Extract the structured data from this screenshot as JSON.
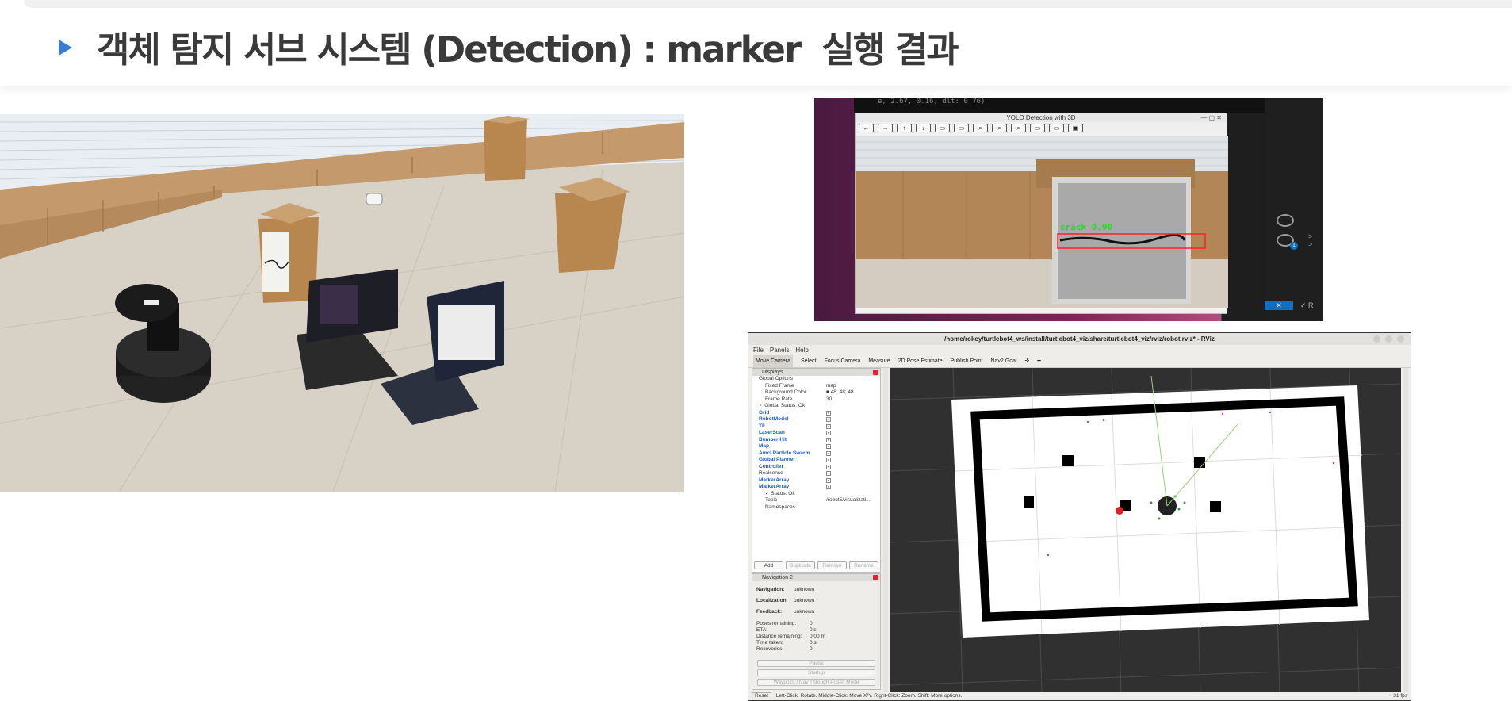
{
  "slide": {
    "title": "객체 탐지 서브 시스템 (Detection) : marker  실행 결과"
  },
  "yolo_window": {
    "terminal_text": "e, 2.67, 0.16, dlt: 0.76)",
    "title": "YOLO Detection with 3D",
    "window_controls": "—  ▢  ✕",
    "toolbar": [
      "←",
      "→",
      "↑",
      "↓",
      "▭",
      "▭",
      "⌕",
      "⌕",
      "⌕",
      "▭",
      "▭",
      "▣"
    ],
    "detection_label": "crack 0.90",
    "sidebar_badge": "1",
    "sidebar_blue": "✕",
    "sidebar_text": "✓ R",
    "sidebar_chevrons": ">"
  },
  "rviz": {
    "window_title": "/home/rokey/turtlebot4_ws/install/turtlebot4_viz/share/turtlebot4_viz/rviz/robot.rviz* - RViz",
    "menu": [
      "File",
      "Panels",
      "Help"
    ],
    "toolbar": [
      "Move Camera",
      "Select",
      "Focus Camera",
      "Measure",
      "2D Pose Estimate",
      "Publish Point",
      "Nav2 Goal",
      "✛",
      "━"
    ],
    "displays_panel_title": "Displays",
    "displays": [
      {
        "label": "Global Options",
        "value": "",
        "blue": false,
        "check": false,
        "indent": 0
      },
      {
        "label": "Fixed Frame",
        "value": "map",
        "blue": false,
        "check": false,
        "indent": 1
      },
      {
        "label": "Background Color",
        "value": "■ 48; 48; 48",
        "blue": false,
        "check": false,
        "indent": 1
      },
      {
        "label": "Frame Rate",
        "value": "30",
        "blue": false,
        "check": false,
        "indent": 1
      },
      {
        "label": "✓ Global Status: Ok",
        "value": "",
        "blue": false,
        "check": false,
        "indent": 0
      },
      {
        "label": "Grid",
        "value": "",
        "blue": true,
        "check": true,
        "indent": 0
      },
      {
        "label": "RobotModel",
        "value": "",
        "blue": true,
        "check": true,
        "indent": 0
      },
      {
        "label": "TF",
        "value": "",
        "blue": true,
        "check": true,
        "indent": 0
      },
      {
        "label": "LaserScan",
        "value": "",
        "blue": true,
        "check": true,
        "indent": 0
      },
      {
        "label": "Bumper Hit",
        "value": "",
        "blue": true,
        "check": true,
        "indent": 0
      },
      {
        "label": "Map",
        "value": "",
        "blue": true,
        "check": true,
        "indent": 0
      },
      {
        "label": "Amcl Particle Swarm",
        "value": "",
        "blue": true,
        "check": true,
        "indent": 0
      },
      {
        "label": "Global Planner",
        "value": "",
        "blue": true,
        "check": true,
        "indent": 0
      },
      {
        "label": "Controller",
        "value": "",
        "blue": true,
        "check": true,
        "indent": 0
      },
      {
        "label": "Realsense",
        "value": "",
        "blue": false,
        "check": true,
        "indent": 0
      },
      {
        "label": "MarkerArray",
        "value": "",
        "blue": true,
        "check": true,
        "indent": 0
      },
      {
        "label": "MarkerArray",
        "value": "",
        "blue": true,
        "check": true,
        "indent": 0
      },
      {
        "label": "✓ Status: Ok",
        "value": "",
        "blue": false,
        "check": false,
        "indent": 1
      },
      {
        "label": "Topic",
        "value": "/robot5/visualizati...",
        "blue": false,
        "check": false,
        "indent": 1
      },
      {
        "label": "Namespaces",
        "value": "",
        "blue": false,
        "check": false,
        "indent": 1
      }
    ],
    "display_buttons": [
      {
        "label": "Add",
        "disabled": false
      },
      {
        "label": "Duplicate",
        "disabled": true
      },
      {
        "label": "Remove",
        "disabled": true
      },
      {
        "label": "Rename",
        "disabled": true
      }
    ],
    "nav_panel_title": "Navigation 2",
    "nav_status": [
      {
        "label": "Navigation:",
        "value": "unknown"
      },
      {
        "label": "Localization:",
        "value": "unknown"
      },
      {
        "label": "Feedback:",
        "value": "unknown"
      }
    ],
    "nav_stats": [
      {
        "label": "Poses remaining:",
        "value": "0"
      },
      {
        "label": "ETA:",
        "value": "0 s"
      },
      {
        "label": "Distance remaining:",
        "value": "0.00 m"
      },
      {
        "label": "Time taken:",
        "value": "0 s"
      },
      {
        "label": "Recoveries:",
        "value": "0"
      }
    ],
    "nav_buttons": [
      "Pause",
      "Startup",
      "Waypoint / Nav Through Poses Mode"
    ],
    "status_reset": "Reset",
    "status_text": "Left-Click: Rotate. Middle-Click: Move X/Y. Right-Click: Zoom. Shift: More options.",
    "fps": "31 fps"
  },
  "colors": {
    "accent": "#3a7bd5",
    "title": "#3a3a3a",
    "rviz_bg": "#303030",
    "detection_box": "#ff2020",
    "detection_label": "#22dd22"
  }
}
